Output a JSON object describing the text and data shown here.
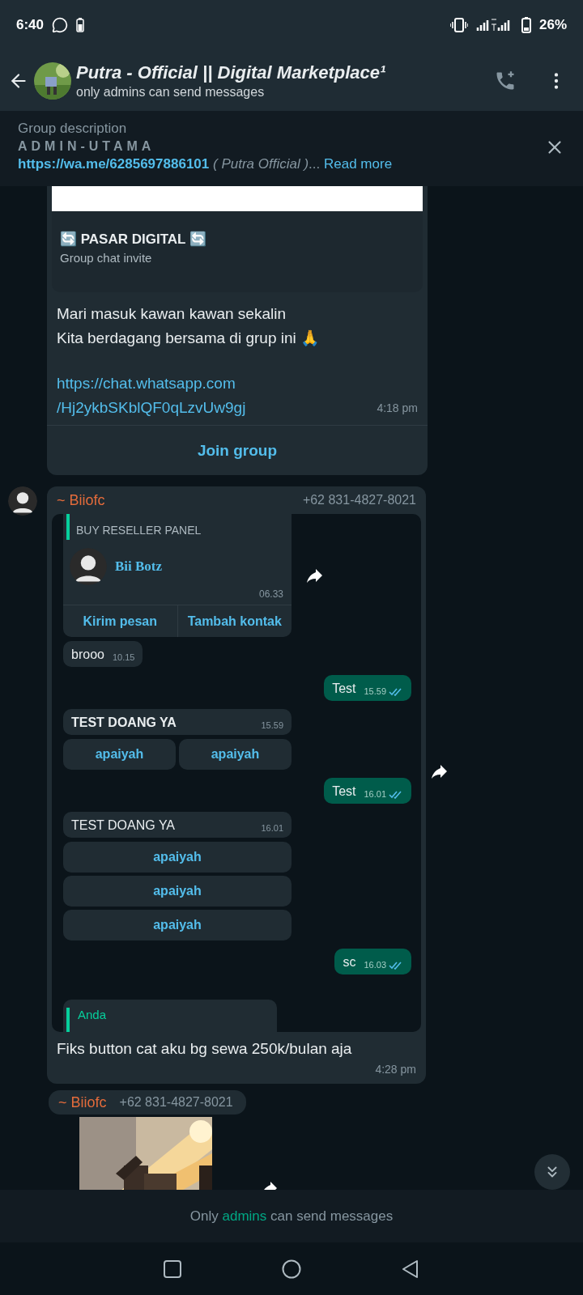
{
  "status_bar": {
    "time": "6:40",
    "battery": "26%"
  },
  "header": {
    "title": "Putra - Official || Digital Marketplace¹",
    "subtitle": "only admins can send messages"
  },
  "group_description": {
    "label": "Group description",
    "heading": "ADMIN-UTAMA",
    "link": "https://wa.me/6285697886101",
    "text": "*( Putra Official )*...",
    "read_more": "Read more"
  },
  "messages": [
    {
      "kind": "invite",
      "card_title": "🔄 PASAR DIGITAL 🔄",
      "card_subtitle": "Group chat invite",
      "lines": [
        "Mari masuk kawan kawan sekalin",
        "Kita berdagang bersama di grup ini 🙏"
      ],
      "link_lines": [
        "https://chat.whatsapp.com",
        "/Hj2ykbSKblQF0qLzvUw9gj"
      ],
      "time": "4:18 pm",
      "action": "Join group"
    },
    {
      "kind": "screenshot",
      "sender": "~ Biiofc",
      "phone": "+62 831-4827-8021",
      "text": "Fiks button cat aku bg sewa 250k/bulan aja",
      "time": "4:28 pm",
      "shot": [
        {
          "kind": "contact",
          "quote": "BUY RESELLER PANEL",
          "name": "Bii Botz",
          "time": "06.33",
          "actions": [
            "Kirim pesan",
            "Tambah kontak"
          ]
        },
        {
          "kind": "in",
          "text": "brooo",
          "time": "10.15"
        },
        {
          "kind": "out",
          "text": "Test",
          "time": "15.59",
          "read": true
        },
        {
          "kind": "buttons_row",
          "text": "TEST DOANG YA",
          "bold": true,
          "time": "15.59",
          "buttons": [
            "apaiyah",
            "apaiyah"
          ]
        },
        {
          "kind": "out",
          "text": "Test",
          "time": "16.01",
          "read": true
        },
        {
          "kind": "buttons_column",
          "text": "TEST DOANG YA",
          "bold": false,
          "time": "16.01",
          "buttons": [
            "apaiyah",
            "apaiyah",
            "apaiyah"
          ]
        },
        {
          "kind": "out",
          "text": "sc",
          "time": "16.03",
          "read": true
        },
        {
          "kind": "quote",
          "author": "Anda"
        }
      ]
    },
    {
      "kind": "media",
      "sender": "~ Biiofc",
      "phone": "+62 831-4827-8021"
    }
  ],
  "notice": "Only **admins** can send messages"
}
